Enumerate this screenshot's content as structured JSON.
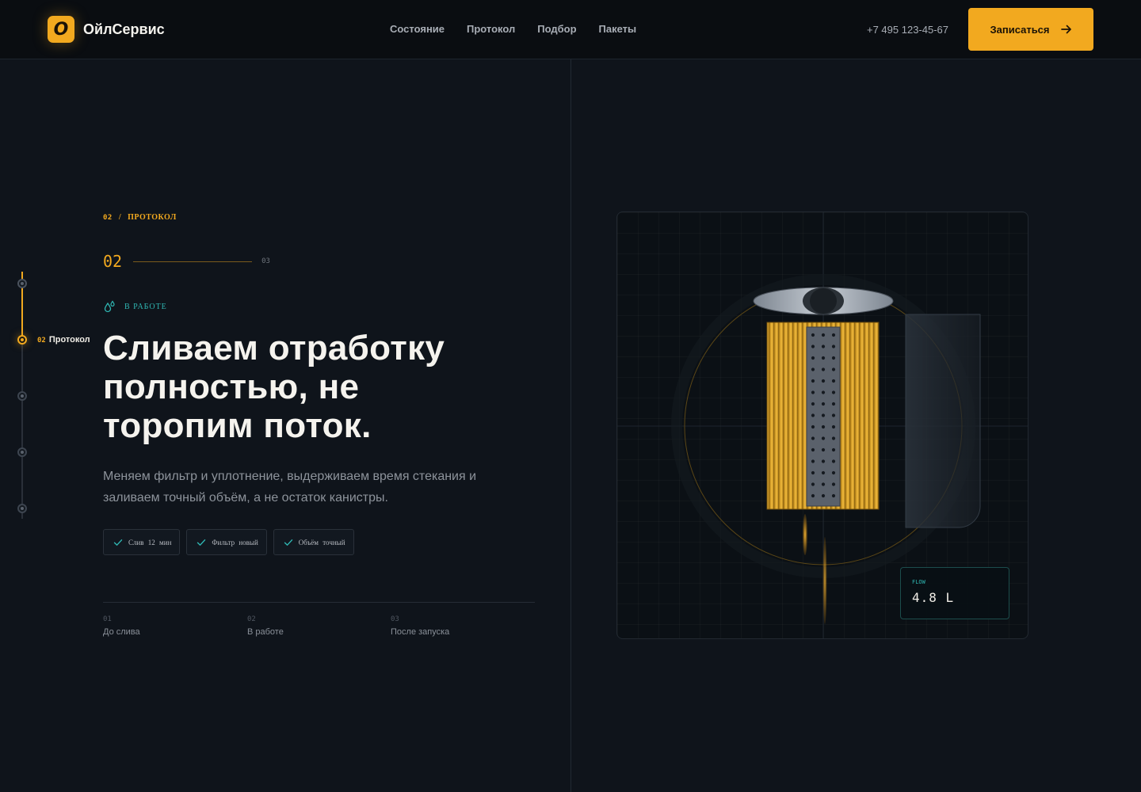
{
  "brand": {
    "logo_letter": "O",
    "name": "ОйлСервис",
    "accent": "#f2a91f",
    "teal": "#2fb6b2"
  },
  "nav": {
    "items": [
      {
        "label": "Состояние"
      },
      {
        "label": "Протокол"
      },
      {
        "label": "Подбор"
      },
      {
        "label": "Пакеты"
      }
    ]
  },
  "header": {
    "phone": "+7 495 123-45-67",
    "cta_label": "Записаться",
    "cta_icon": "arrow-right-icon"
  },
  "stepper": {
    "active_step": 2,
    "total_steps": 5,
    "active_num": "02",
    "active_label": "Протокол"
  },
  "section": {
    "eyebrow_num": "02",
    "eyebrow_sep": "/",
    "eyebrow_label": "ПРОТОКОЛ",
    "progress_current": "02",
    "progress_next": "03",
    "status_icon": "drops-icon",
    "status_label": "В РАБОТЕ",
    "headline": "Сливаем отработку полностью, не торопим поток.",
    "lead": "Меняем фильтр и уплотнение, выдерживаем время стекания и заливаем точный объём, а не остаток канистры.",
    "chips": [
      {
        "label": "Слив 12 мин",
        "icon": "check-icon"
      },
      {
        "label": "Фильтр новый",
        "icon": "check-icon"
      },
      {
        "label": "Объём точный",
        "icon": "check-icon"
      }
    ],
    "stats": [
      {
        "num": "01",
        "label": "До слива"
      },
      {
        "num": "02",
        "label": "В работе"
      },
      {
        "num": "03",
        "label": "После запуска"
      }
    ]
  },
  "visual": {
    "readout_key": "FLOW",
    "readout_value": "4.8 L"
  }
}
